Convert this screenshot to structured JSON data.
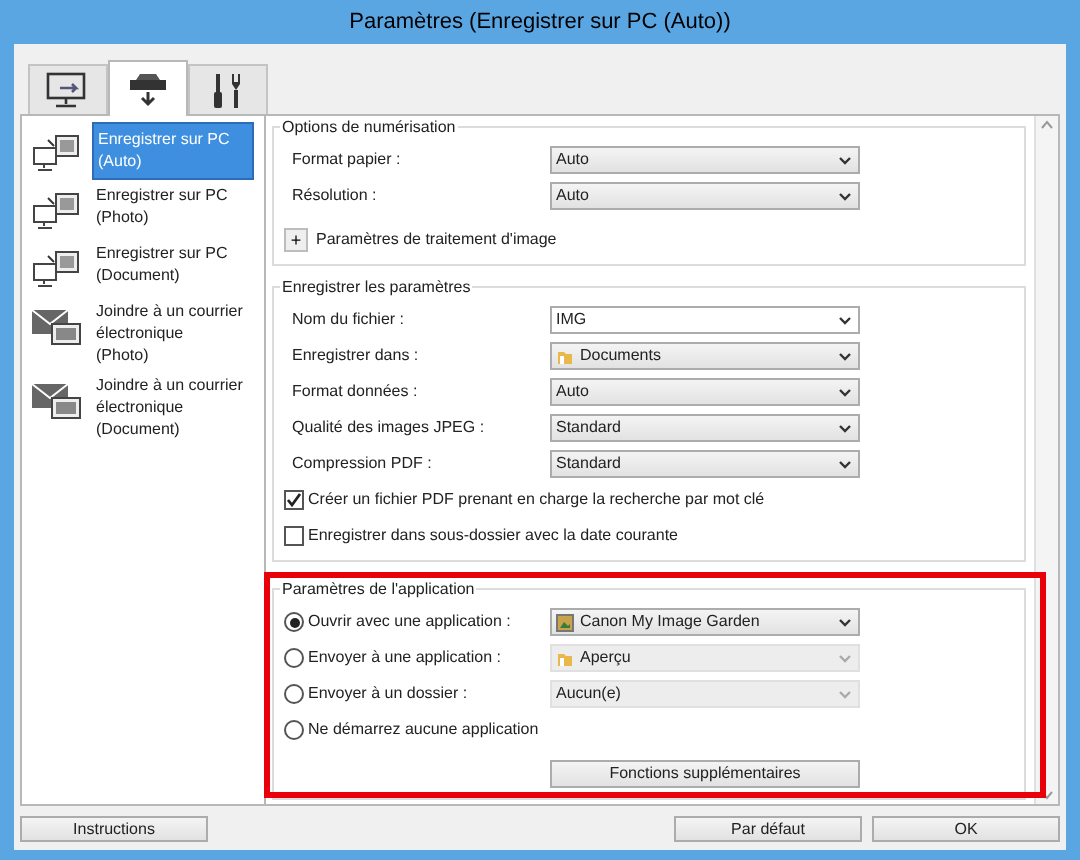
{
  "window": {
    "title": "Paramètres (Enregistrer sur PC (Auto))"
  },
  "tabs": [
    {
      "kind": "scan",
      "selected": false
    },
    {
      "kind": "save",
      "selected": true
    },
    {
      "kind": "tools",
      "selected": false
    }
  ],
  "sidebar": {
    "items": [
      {
        "kind": "pc",
        "lines": [
          "Enregistrer sur PC",
          "(Auto)"
        ],
        "selected": true
      },
      {
        "kind": "pc",
        "lines": [
          "Enregistrer sur PC",
          "(Photo)"
        ],
        "selected": false
      },
      {
        "kind": "pc",
        "lines": [
          "Enregistrer sur PC",
          "(Document)"
        ],
        "selected": false
      },
      {
        "kind": "mail",
        "lines": [
          "Joindre à un courrier",
          "électronique",
          "(Photo)"
        ],
        "selected": false
      },
      {
        "kind": "mail",
        "lines": [
          "Joindre à un courrier",
          "électronique",
          "(Document)"
        ],
        "selected": false
      }
    ]
  },
  "scan_options": {
    "title": "Options de numérisation",
    "rows": [
      {
        "label": "Format papier :",
        "value": "Auto"
      },
      {
        "label": "Résolution :",
        "value": "Auto"
      }
    ],
    "expander": {
      "symbol": "+",
      "label": "Paramètres de traitement d'image"
    }
  },
  "save_settings": {
    "title": "Enregistrer les paramètres",
    "rows": [
      {
        "label": "Nom du fichier :",
        "value": "IMG",
        "kind": "combo"
      },
      {
        "label": "Enregistrer dans :",
        "value": "Documents",
        "kind": "folder"
      },
      {
        "label": "Format données :",
        "value": "Auto",
        "kind": "select"
      },
      {
        "label": "Qualité des images JPEG :",
        "value": "Standard",
        "kind": "select"
      },
      {
        "label": "Compression PDF :",
        "value": "Standard",
        "kind": "select"
      }
    ],
    "checkboxes": [
      {
        "label": "Créer un fichier PDF prenant en charge la recherche par mot clé",
        "checked": true
      },
      {
        "label": "Enregistrer dans sous-dossier avec la date courante",
        "checked": false
      }
    ]
  },
  "app_settings": {
    "title": "Paramètres de l'application",
    "options": [
      {
        "label": "Ouvrir avec une application :",
        "selected": true,
        "value": "Canon My Image Garden",
        "kind": "app",
        "disabled": false
      },
      {
        "label": "Envoyer à une application :",
        "selected": false,
        "value": "Aperçu",
        "kind": "folder",
        "disabled": true
      },
      {
        "label": "Envoyer à un dossier :",
        "selected": false,
        "value": "Aucun(e)",
        "disabled": true
      },
      {
        "label": "Ne démarrez aucune application",
        "selected": false
      }
    ],
    "button": "Fonctions supplémentaires"
  },
  "footer": {
    "buttons": [
      "Instructions",
      "Par défaut",
      "OK"
    ]
  }
}
